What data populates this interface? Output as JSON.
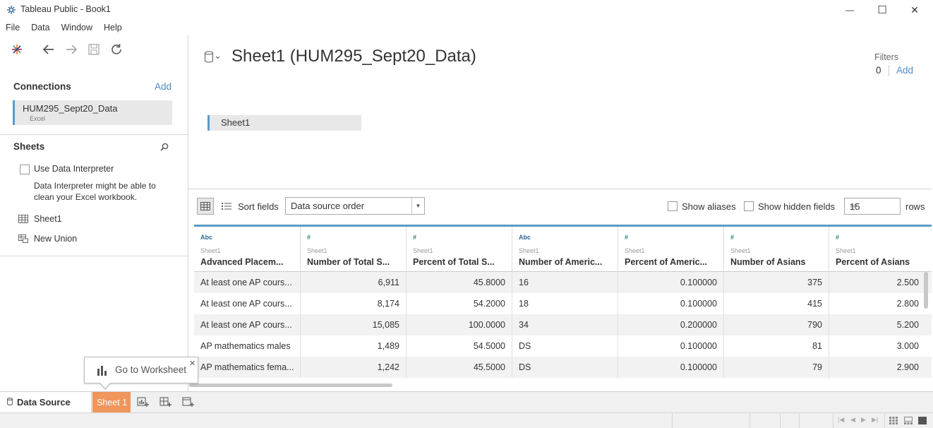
{
  "window": {
    "title": "Tableau Public - Book1",
    "minimize_glyph": "—",
    "maximize_glyph": "☐",
    "close_glyph": "✕"
  },
  "menu": [
    "File",
    "Data",
    "Window",
    "Help"
  ],
  "left_panel": {
    "connections_header": "Connections",
    "connections_add": "Add",
    "connection": {
      "name": "HUM295_Sept20_Data",
      "type": "Excel"
    },
    "sheets_header": "Sheets",
    "use_interpreter_label": "Use Data Interpreter",
    "interpreter_desc": "Data Interpreter might be able to clean your Excel workbook.",
    "sheets": [
      "Sheet1",
      "New Union"
    ]
  },
  "canvas": {
    "title": "Sheet1 (HUM295_Sept20_Data)",
    "filters_label": "Filters",
    "filters_count": "0",
    "filters_add": "Add",
    "sheet_pill": "Sheet1"
  },
  "grid_toolbar": {
    "sort_label": "Sort fields",
    "sort_value": "Data source order",
    "show_aliases": "Show aliases",
    "show_hidden": "Show hidden fields",
    "rows_value": "15",
    "rows_label": "rows"
  },
  "columns": [
    {
      "type": "Abc",
      "table": "Sheet1",
      "name": "Advanced Placem..."
    },
    {
      "type": "#",
      "table": "Sheet1",
      "name": "Number of Total S..."
    },
    {
      "type": "#",
      "table": "Sheet1",
      "name": "Percent of Total S..."
    },
    {
      "type": "Abc",
      "table": "Sheet1",
      "name": "Number of Americ..."
    },
    {
      "type": "#",
      "table": "Sheet1",
      "name": "Percent of Americ..."
    },
    {
      "type": "#",
      "table": "Sheet1",
      "name": "Number of Asians"
    },
    {
      "type": "#",
      "table": "Sheet1",
      "name": "Percent of Asians"
    }
  ],
  "rows": [
    [
      "At least one AP cours...",
      "6,911",
      "45.8000",
      "16",
      "0.100000",
      "375",
      "2.500"
    ],
    [
      "At least one AP cours...",
      "8,174",
      "54.2000",
      "18",
      "0.100000",
      "415",
      "2.800"
    ],
    [
      "At least one AP cours...",
      "15,085",
      "100.0000",
      "34",
      "0.200000",
      "790",
      "5.200"
    ],
    [
      "AP mathematics males",
      "1,489",
      "54.5000",
      "DS",
      "0.100000",
      "81",
      "3.000"
    ],
    [
      "AP mathematics fema...",
      "1,242",
      "45.5000",
      "DS",
      "0.100000",
      "79",
      "2.900"
    ]
  ],
  "tooltip": {
    "label": "Go to Worksheet",
    "close": "✕"
  },
  "tabs": {
    "data_source": "Data Source",
    "sheet": "Sheet 1"
  },
  "colors": {
    "accent_blue": "#5b9bc8",
    "sheet_tab_orange": "#f0955b",
    "link_blue": "#4f8bc2"
  }
}
